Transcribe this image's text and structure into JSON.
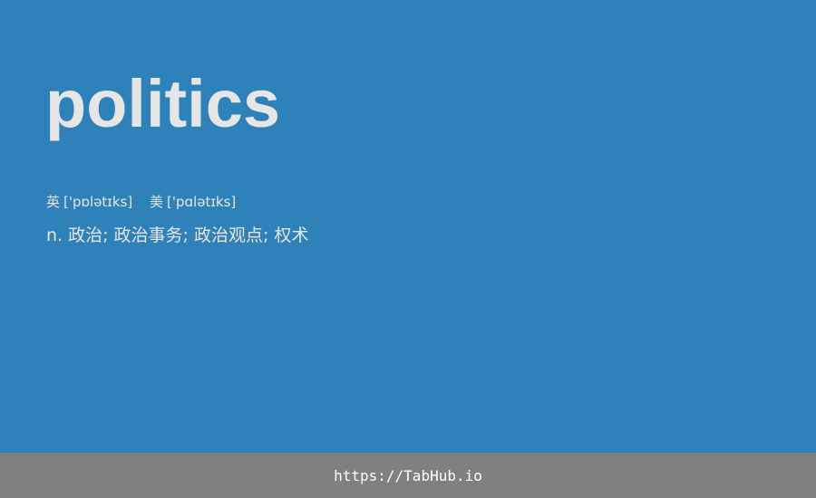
{
  "entry": {
    "word": "politics",
    "phonetics": [
      {
        "label": "英",
        "ipa": "['pɒlətɪks]"
      },
      {
        "label": "美",
        "ipa": "['pɑlətɪks]"
      }
    ],
    "definition": "n. 政治; 政治事务; 政治观点; 权术"
  },
  "footer": {
    "link_text": "https://TabHub.io"
  },
  "colors": {
    "background": "#2f81b9",
    "text": "#e6e6e6",
    "footer_background": "#808080",
    "footer_text": "#ffffff"
  }
}
